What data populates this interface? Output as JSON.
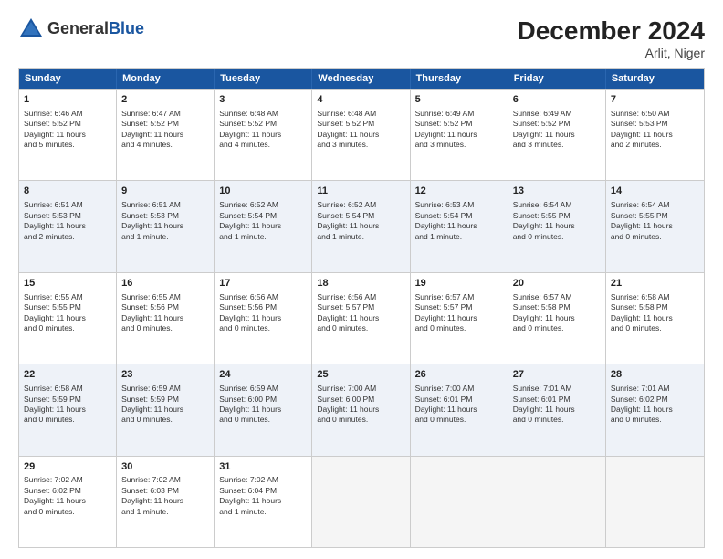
{
  "header": {
    "logo_general": "General",
    "logo_blue": "Blue",
    "month_title": "December 2024",
    "subtitle": "Arlit, Niger"
  },
  "days_of_week": [
    "Sunday",
    "Monday",
    "Tuesday",
    "Wednesday",
    "Thursday",
    "Friday",
    "Saturday"
  ],
  "rows": [
    [
      {
        "day": "1",
        "lines": [
          "Sunrise: 6:46 AM",
          "Sunset: 5:52 PM",
          "Daylight: 11 hours",
          "and 5 minutes."
        ]
      },
      {
        "day": "2",
        "lines": [
          "Sunrise: 6:47 AM",
          "Sunset: 5:52 PM",
          "Daylight: 11 hours",
          "and 4 minutes."
        ]
      },
      {
        "day": "3",
        "lines": [
          "Sunrise: 6:48 AM",
          "Sunset: 5:52 PM",
          "Daylight: 11 hours",
          "and 4 minutes."
        ]
      },
      {
        "day": "4",
        "lines": [
          "Sunrise: 6:48 AM",
          "Sunset: 5:52 PM",
          "Daylight: 11 hours",
          "and 3 minutes."
        ]
      },
      {
        "day": "5",
        "lines": [
          "Sunrise: 6:49 AM",
          "Sunset: 5:52 PM",
          "Daylight: 11 hours",
          "and 3 minutes."
        ]
      },
      {
        "day": "6",
        "lines": [
          "Sunrise: 6:49 AM",
          "Sunset: 5:52 PM",
          "Daylight: 11 hours",
          "and 3 minutes."
        ]
      },
      {
        "day": "7",
        "lines": [
          "Sunrise: 6:50 AM",
          "Sunset: 5:53 PM",
          "Daylight: 11 hours",
          "and 2 minutes."
        ]
      }
    ],
    [
      {
        "day": "8",
        "lines": [
          "Sunrise: 6:51 AM",
          "Sunset: 5:53 PM",
          "Daylight: 11 hours",
          "and 2 minutes."
        ]
      },
      {
        "day": "9",
        "lines": [
          "Sunrise: 6:51 AM",
          "Sunset: 5:53 PM",
          "Daylight: 11 hours",
          "and 1 minute."
        ]
      },
      {
        "day": "10",
        "lines": [
          "Sunrise: 6:52 AM",
          "Sunset: 5:54 PM",
          "Daylight: 11 hours",
          "and 1 minute."
        ]
      },
      {
        "day": "11",
        "lines": [
          "Sunrise: 6:52 AM",
          "Sunset: 5:54 PM",
          "Daylight: 11 hours",
          "and 1 minute."
        ]
      },
      {
        "day": "12",
        "lines": [
          "Sunrise: 6:53 AM",
          "Sunset: 5:54 PM",
          "Daylight: 11 hours",
          "and 1 minute."
        ]
      },
      {
        "day": "13",
        "lines": [
          "Sunrise: 6:54 AM",
          "Sunset: 5:55 PM",
          "Daylight: 11 hours",
          "and 0 minutes."
        ]
      },
      {
        "day": "14",
        "lines": [
          "Sunrise: 6:54 AM",
          "Sunset: 5:55 PM",
          "Daylight: 11 hours",
          "and 0 minutes."
        ]
      }
    ],
    [
      {
        "day": "15",
        "lines": [
          "Sunrise: 6:55 AM",
          "Sunset: 5:55 PM",
          "Daylight: 11 hours",
          "and 0 minutes."
        ]
      },
      {
        "day": "16",
        "lines": [
          "Sunrise: 6:55 AM",
          "Sunset: 5:56 PM",
          "Daylight: 11 hours",
          "and 0 minutes."
        ]
      },
      {
        "day": "17",
        "lines": [
          "Sunrise: 6:56 AM",
          "Sunset: 5:56 PM",
          "Daylight: 11 hours",
          "and 0 minutes."
        ]
      },
      {
        "day": "18",
        "lines": [
          "Sunrise: 6:56 AM",
          "Sunset: 5:57 PM",
          "Daylight: 11 hours",
          "and 0 minutes."
        ]
      },
      {
        "day": "19",
        "lines": [
          "Sunrise: 6:57 AM",
          "Sunset: 5:57 PM",
          "Daylight: 11 hours",
          "and 0 minutes."
        ]
      },
      {
        "day": "20",
        "lines": [
          "Sunrise: 6:57 AM",
          "Sunset: 5:58 PM",
          "Daylight: 11 hours",
          "and 0 minutes."
        ]
      },
      {
        "day": "21",
        "lines": [
          "Sunrise: 6:58 AM",
          "Sunset: 5:58 PM",
          "Daylight: 11 hours",
          "and 0 minutes."
        ]
      }
    ],
    [
      {
        "day": "22",
        "lines": [
          "Sunrise: 6:58 AM",
          "Sunset: 5:59 PM",
          "Daylight: 11 hours",
          "and 0 minutes."
        ]
      },
      {
        "day": "23",
        "lines": [
          "Sunrise: 6:59 AM",
          "Sunset: 5:59 PM",
          "Daylight: 11 hours",
          "and 0 minutes."
        ]
      },
      {
        "day": "24",
        "lines": [
          "Sunrise: 6:59 AM",
          "Sunset: 6:00 PM",
          "Daylight: 11 hours",
          "and 0 minutes."
        ]
      },
      {
        "day": "25",
        "lines": [
          "Sunrise: 7:00 AM",
          "Sunset: 6:00 PM",
          "Daylight: 11 hours",
          "and 0 minutes."
        ]
      },
      {
        "day": "26",
        "lines": [
          "Sunrise: 7:00 AM",
          "Sunset: 6:01 PM",
          "Daylight: 11 hours",
          "and 0 minutes."
        ]
      },
      {
        "day": "27",
        "lines": [
          "Sunrise: 7:01 AM",
          "Sunset: 6:01 PM",
          "Daylight: 11 hours",
          "and 0 minutes."
        ]
      },
      {
        "day": "28",
        "lines": [
          "Sunrise: 7:01 AM",
          "Sunset: 6:02 PM",
          "Daylight: 11 hours",
          "and 0 minutes."
        ]
      }
    ],
    [
      {
        "day": "29",
        "lines": [
          "Sunrise: 7:02 AM",
          "Sunset: 6:02 PM",
          "Daylight: 11 hours",
          "and 0 minutes."
        ]
      },
      {
        "day": "30",
        "lines": [
          "Sunrise: 7:02 AM",
          "Sunset: 6:03 PM",
          "Daylight: 11 hours",
          "and 1 minute."
        ]
      },
      {
        "day": "31",
        "lines": [
          "Sunrise: 7:02 AM",
          "Sunset: 6:04 PM",
          "Daylight: 11 hours",
          "and 1 minute."
        ]
      },
      {
        "day": "",
        "lines": []
      },
      {
        "day": "",
        "lines": []
      },
      {
        "day": "",
        "lines": []
      },
      {
        "day": "",
        "lines": []
      }
    ]
  ]
}
